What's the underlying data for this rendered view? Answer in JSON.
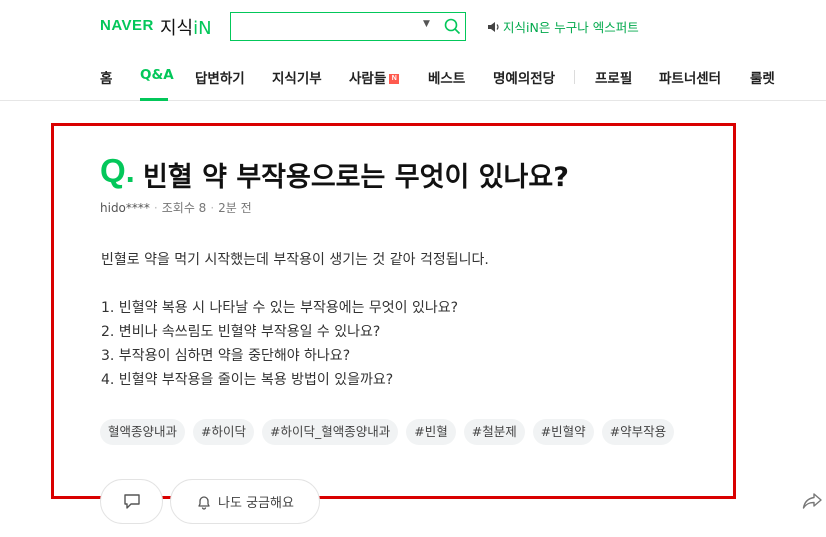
{
  "header": {
    "logo_naver": "NAVER",
    "logo_kin_prefix": "지식",
    "logo_kin_suffix": "iN",
    "search_value": "",
    "notice": "지식iN은 누구나 엑스퍼트",
    "colors": {
      "brand": "#03c75a"
    },
    "icons": [
      "dropdown-caret-icon",
      "search-icon",
      "speaker-icon"
    ]
  },
  "nav": {
    "items": [
      "홈",
      "Q&A",
      "답변하기",
      "지식기부",
      "사람들",
      "베스트",
      "명예의전당",
      "프로필",
      "파트너센터",
      "룰렛"
    ],
    "active": "Q&A",
    "new_badge": "N"
  },
  "question": {
    "q_mark": "Q.",
    "title": "빈혈 약 부작용으로는 무엇이 있나요?",
    "author": "hido****",
    "views": "조회수 8",
    "time": "2분 전",
    "intro": "빈혈로 약을 먹기 시작했는데 부작용이 생기는 것 같아 걱정됩니다.",
    "items": [
      "1. 빈혈약 복용 시 나타날 수 있는 부작용에는 무엇이 있나요?",
      "2. 변비나 속쓰림도 빈혈약 부작용일 수 있나요?",
      "3. 부작용이 심하면 약을 중단해야 하나요?",
      "4. 빈혈약 부작용을 줄이는 복용 방법이 있을까요?"
    ],
    "tags": [
      "혈액종양내과",
      "#하이닥",
      "#하이닥_혈액종양내과",
      "#빈혈",
      "#철분제",
      "#빈혈약",
      "#약부작용"
    ],
    "empathy_label": "나도 궁금해요"
  },
  "colors": {
    "highlight_frame": "#d90000"
  }
}
